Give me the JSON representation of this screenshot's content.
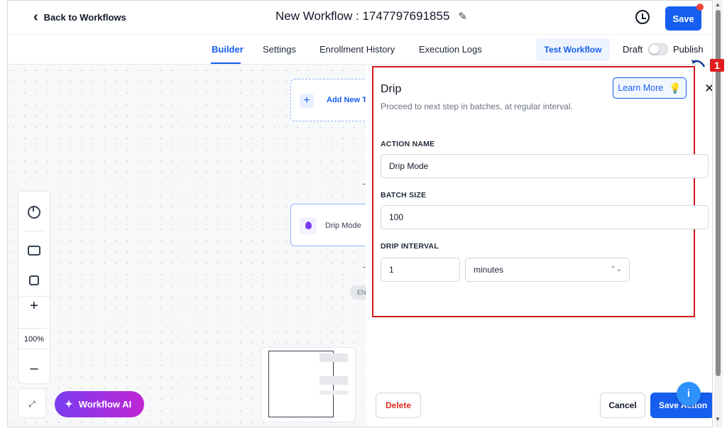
{
  "header": {
    "back_label": "Back to Workflows",
    "title": "New Workflow : 1747797691855",
    "save_label": "Save"
  },
  "tabs": [
    {
      "label": "Builder",
      "active": true
    },
    {
      "label": "Settings",
      "active": false
    },
    {
      "label": "Enrollment History",
      "active": false
    },
    {
      "label": "Execution Logs",
      "active": false
    }
  ],
  "actions": {
    "test_label": "Test Workflow",
    "draft_label": "Draft",
    "publish_label": "Publish",
    "published": false
  },
  "canvas": {
    "trigger_label": "Add New Tr",
    "node_label": "Drip Mode",
    "end_label": "EN",
    "zoom": "100%",
    "ai_label": "Workflow AI"
  },
  "panel": {
    "title": "Drip",
    "description": "Proceed to next step in batches, at regular interval.",
    "learn_more": "Learn More",
    "action_name_label": "ACTION NAME",
    "action_name_value": "Drip Mode",
    "batch_size_label": "BATCH SIZE",
    "batch_size_value": "100",
    "drip_interval_label": "DRIP INTERVAL",
    "drip_interval_value": "1",
    "drip_interval_unit": "minutes",
    "delete_label": "Delete",
    "cancel_label": "Cancel",
    "save_action_label": "Save Action"
  },
  "annotation": {
    "number": "1"
  },
  "colors": {
    "primary": "#155eef",
    "danger": "#d92d20",
    "highlight": "#d3191c",
    "ai_gradient_start": "#7a3cf0",
    "ai_gradient_end": "#c026d3"
  }
}
